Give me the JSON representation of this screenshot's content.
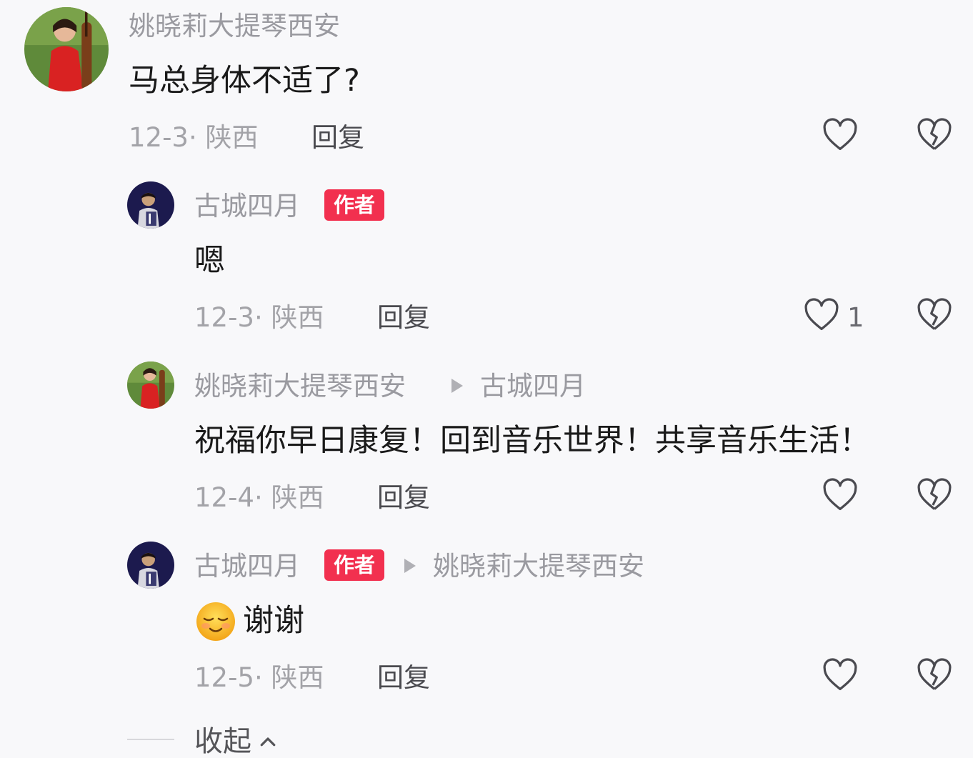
{
  "comments": [
    {
      "username": "姚晓莉大提琴西安",
      "text": "马总身体不适了?",
      "meta": "12-3· 陕西",
      "reply_label": "回复",
      "likes": ""
    },
    {
      "username": "古城四月",
      "badge": "作者",
      "text": "嗯",
      "meta": "12-3· 陕西",
      "reply_label": "回复",
      "likes": "1"
    },
    {
      "username": "姚晓莉大提琴西安",
      "reply_to": "古城四月",
      "text": "祝福你早日康复！回到音乐世界！共享音乐生活！",
      "meta": "12-4· 陕西",
      "reply_label": "回复",
      "likes": ""
    },
    {
      "username": "古城四月",
      "badge": "作者",
      "reply_to": "姚晓莉大提琴西安",
      "text": "谢谢",
      "emoji": "relieved-face-emoji",
      "meta": "12-5· 陕西",
      "reply_label": "回复",
      "likes": ""
    }
  ],
  "collapse_label": "收起",
  "icons": {
    "like": "heart-outline-icon",
    "dislike": "broken-heart-icon",
    "reply_arrow": "triangle-right-icon",
    "collapse": "chevron-up-icon"
  },
  "colors": {
    "badge": "#f2304f",
    "username": "#9a9aa0",
    "text": "#1a1a1a",
    "meta": "#a3a3a8",
    "background": "#f8f8fa"
  }
}
